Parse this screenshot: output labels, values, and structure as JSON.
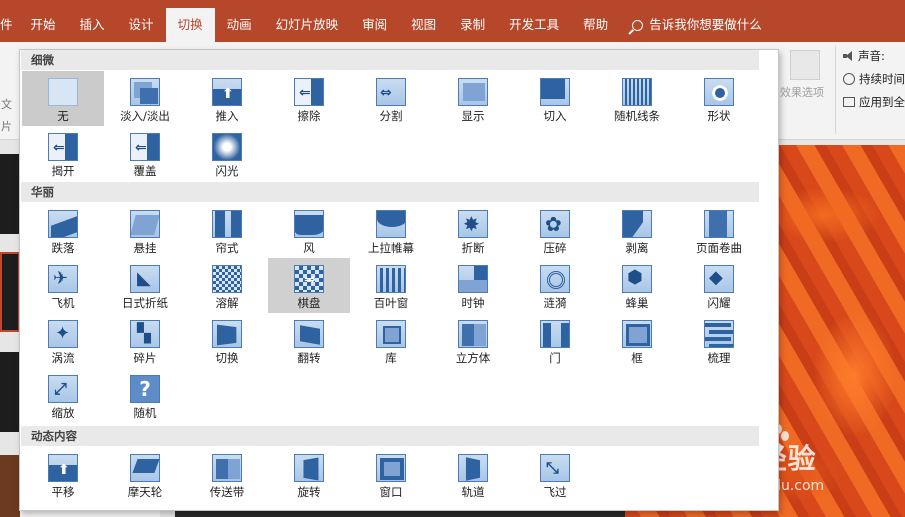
{
  "ribbon_tabs": [
    "开始",
    "插入",
    "设计",
    "切换",
    "动画",
    "幻灯片放映",
    "审阅",
    "视图",
    "录制",
    "开发工具",
    "帮助"
  ],
  "active_tab_index": 3,
  "tell_me": "告诉我你想要做什么",
  "ribbon": {
    "effect_options": "效果选项",
    "sound": "声音:",
    "duration": "持续时间",
    "apply_all": "应用到全"
  },
  "left_chars": [
    "件",
    "文",
    "片"
  ],
  "gallery": {
    "sections": [
      {
        "title": "细微",
        "items": [
          {
            "label": "无",
            "icon": "none-icon",
            "selected": true
          },
          {
            "label": "淡入/淡出",
            "icon": "fade-icon"
          },
          {
            "label": "推入",
            "icon": "push-icon"
          },
          {
            "label": "擦除",
            "icon": "wipe-icon"
          },
          {
            "label": "分割",
            "icon": "split-icon"
          },
          {
            "label": "显示",
            "icon": "reveal-icon"
          },
          {
            "label": "切入",
            "icon": "cut-icon"
          },
          {
            "label": "随机线条",
            "icon": "random-bars-icon"
          },
          {
            "label": "形状",
            "icon": "shape-icon"
          },
          {
            "label": "揭开",
            "icon": "uncover-icon"
          },
          {
            "label": "覆盖",
            "icon": "cover-icon"
          },
          {
            "label": "闪光",
            "icon": "flash-icon"
          }
        ]
      },
      {
        "title": "华丽",
        "items": [
          {
            "label": "跌落",
            "icon": "fall-over-icon"
          },
          {
            "label": "悬挂",
            "icon": "drape-icon"
          },
          {
            "label": "帘式",
            "icon": "curtains-icon"
          },
          {
            "label": "风",
            "icon": "wind-icon"
          },
          {
            "label": "上拉帷幕",
            "icon": "prestige-icon"
          },
          {
            "label": "折断",
            "icon": "fracture-icon"
          },
          {
            "label": "压碎",
            "icon": "crush-icon"
          },
          {
            "label": "剥离",
            "icon": "peel-off-icon"
          },
          {
            "label": "页面卷曲",
            "icon": "page-curl-icon"
          },
          {
            "label": "飞机",
            "icon": "airplane-icon"
          },
          {
            "label": "日式折纸",
            "icon": "origami-icon"
          },
          {
            "label": "溶解",
            "icon": "dissolve-icon"
          },
          {
            "label": "棋盘",
            "icon": "checkerboard-icon",
            "hovered": true
          },
          {
            "label": "百叶窗",
            "icon": "blinds-icon"
          },
          {
            "label": "时钟",
            "icon": "clock-icon"
          },
          {
            "label": "涟漪",
            "icon": "ripple-icon"
          },
          {
            "label": "蜂巢",
            "icon": "honeycomb-icon"
          },
          {
            "label": "闪耀",
            "icon": "glitter-icon"
          },
          {
            "label": "涡流",
            "icon": "vortex-icon"
          },
          {
            "label": "碎片",
            "icon": "shred-icon"
          },
          {
            "label": "切换",
            "icon": "switch-icon"
          },
          {
            "label": "翻转",
            "icon": "flip-icon"
          },
          {
            "label": "库",
            "icon": "gallery-icon"
          },
          {
            "label": "立方体",
            "icon": "cube-icon"
          },
          {
            "label": "门",
            "icon": "doors-icon"
          },
          {
            "label": "框",
            "icon": "box-icon"
          },
          {
            "label": "梳理",
            "icon": "comb-icon"
          },
          {
            "label": "缩放",
            "icon": "zoom-icon"
          },
          {
            "label": "随机",
            "icon": "random-icon"
          }
        ]
      },
      {
        "title": "动态内容",
        "items": [
          {
            "label": "平移",
            "icon": "pan-icon"
          },
          {
            "label": "摩天轮",
            "icon": "ferris-wheel-icon"
          },
          {
            "label": "传送带",
            "icon": "conveyor-icon"
          },
          {
            "label": "旋转",
            "icon": "rotate-icon"
          },
          {
            "label": "窗口",
            "icon": "window-icon"
          },
          {
            "label": "轨道",
            "icon": "orbit-icon"
          },
          {
            "label": "飞过",
            "icon": "fly-through-icon"
          }
        ]
      }
    ]
  },
  "watermark": {
    "logo": "Bai 经验",
    "url": "jingyan.baidu.com"
  }
}
